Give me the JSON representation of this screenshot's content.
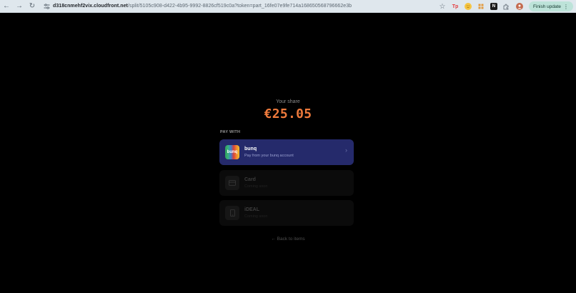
{
  "browser": {
    "back_icon": "←",
    "forward_icon": "→",
    "reload_icon": "↻",
    "url_host": "d318cnmehf2vix.cloudfront.net",
    "url_path": "/split/5105c908-d422-4b95-9992-8826cf519c0a?token=part_16fe07e9fe714a168650568796662e3b",
    "bookmark_icon": "☆",
    "ext_tp_label": "Tp",
    "ext_n_label": "N",
    "finish_update_label": "Finish update",
    "menu_icon": "⋮"
  },
  "payment": {
    "share_label": "Your share",
    "amount": "€25.05",
    "pay_with_label": "PAY WITH",
    "methods": [
      {
        "name": "bunq",
        "subtitle": "Pay from your bunq account",
        "logo_text": "bunq",
        "icon": "bunq-logo",
        "chevron": "›"
      },
      {
        "name": "Card",
        "subtitle": "Coming soon",
        "icon": "card-icon"
      },
      {
        "name": "iDEAL",
        "subtitle": "Coming soon",
        "icon": "phone-icon"
      }
    ],
    "back_link": "← Back to items"
  },
  "colors": {
    "amount": "#ee7a3c",
    "active_method_bg": "#252a6b",
    "chrome_bg": "#dfe7ed",
    "finish_update_bg": "#bde3d9"
  }
}
